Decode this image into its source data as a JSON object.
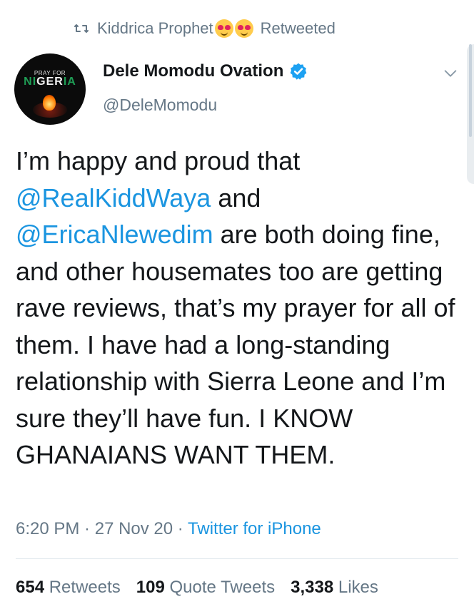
{
  "retweet_banner": {
    "retweeter_name": "Kiddrica Prophet",
    "label": "Retweeted",
    "emojis": [
      "smiling-face-with-hearts",
      "heart-eyes"
    ]
  },
  "author": {
    "display_name": "Dele Momodu Ovation",
    "handle": "@DeleMomodu",
    "avatar_text_small": "PRAY FOR",
    "avatar_text_ni": "NI",
    "avatar_text_ger": "GER",
    "avatar_text_ia": "IA",
    "verified": true
  },
  "tweet": {
    "text_1": "I’m happy and proud that ",
    "mention_1": "@RealKiddWaya",
    "text_2": " and ",
    "mention_2": "@EricaNlewedim",
    "text_3": " are both doing fine, and other housemates too are getting rave reviews, that’s my prayer for all of them. I have had a long-standing relationship with Sierra Leone and I’m sure they’ll have fun. I KNOW GHANAIANS WANT THEM."
  },
  "meta": {
    "time": "6:20 PM",
    "separator": " · ",
    "date": "27 Nov 20",
    "source": "Twitter for iPhone"
  },
  "stats": {
    "retweets_count": "654",
    "retweets_label": "Retweets",
    "quotes_count": "109",
    "quotes_label": "Quote Tweets",
    "likes_count": "3,338",
    "likes_label": "Likes"
  },
  "colors": {
    "link": "#1b95e0",
    "secondary": "#657786",
    "primary_text": "#14171a"
  }
}
